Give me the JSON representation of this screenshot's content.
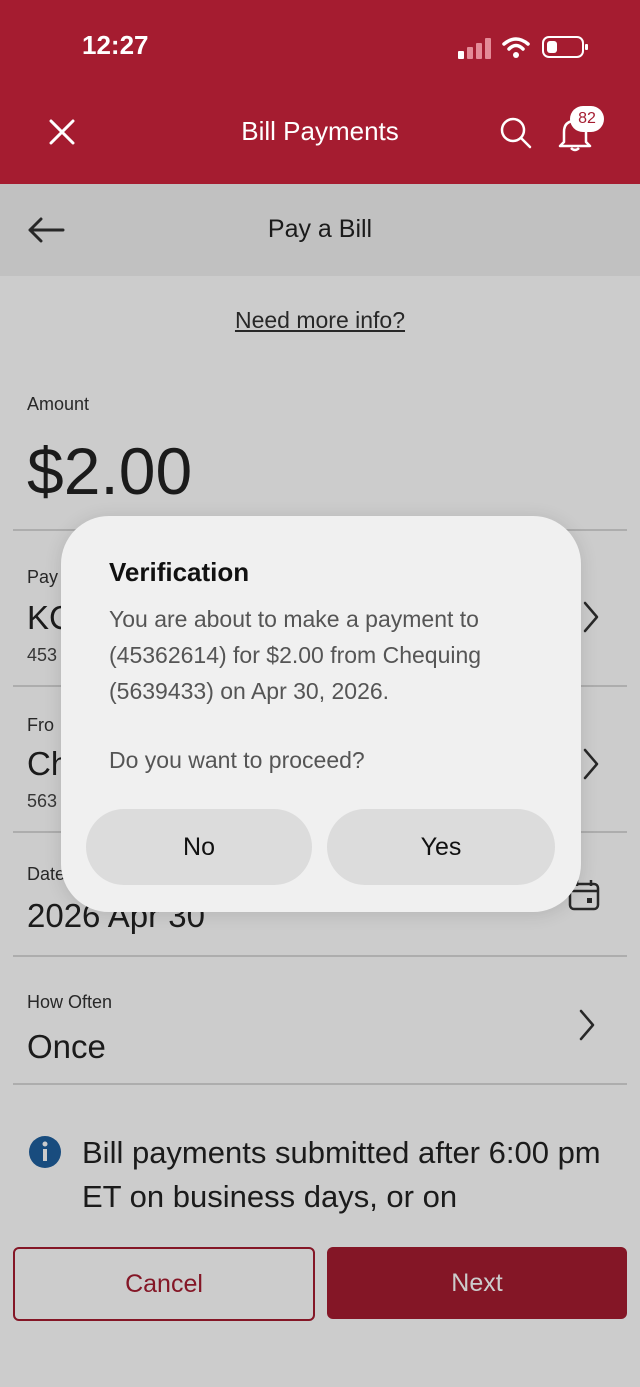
{
  "status_bar": {
    "time": "12:27"
  },
  "header": {
    "title": "Bill Payments",
    "notification_count": "82"
  },
  "subheader": {
    "title": "Pay a Bill"
  },
  "help_link": "Need more info?",
  "amount": {
    "label": "Amount",
    "value": "$2.00"
  },
  "payee": {
    "label_partial": "Pay",
    "name_partial": "KC",
    "number_partial": "453"
  },
  "from_account": {
    "label_partial": "Fro",
    "name_partial": "Ch",
    "number_partial": "563"
  },
  "date": {
    "label_partial": "Date",
    "value": "2026 Apr 30"
  },
  "frequency": {
    "label": "How Often",
    "value": "Once"
  },
  "info_notice": "Bill payments submitted after 6:00 pm ET on business days, or on",
  "footer": {
    "cancel": "Cancel",
    "next": "Next"
  },
  "dialog": {
    "title": "Verification",
    "message": "You are about to make a payment to (45362614) for $2.00 from Chequing (5639433) on Apr 30, 2026.",
    "question": "Do you want to proceed?",
    "no": "No",
    "yes": "Yes"
  },
  "colors": {
    "brand": "#a51c30",
    "info": "#1f5f9e"
  }
}
